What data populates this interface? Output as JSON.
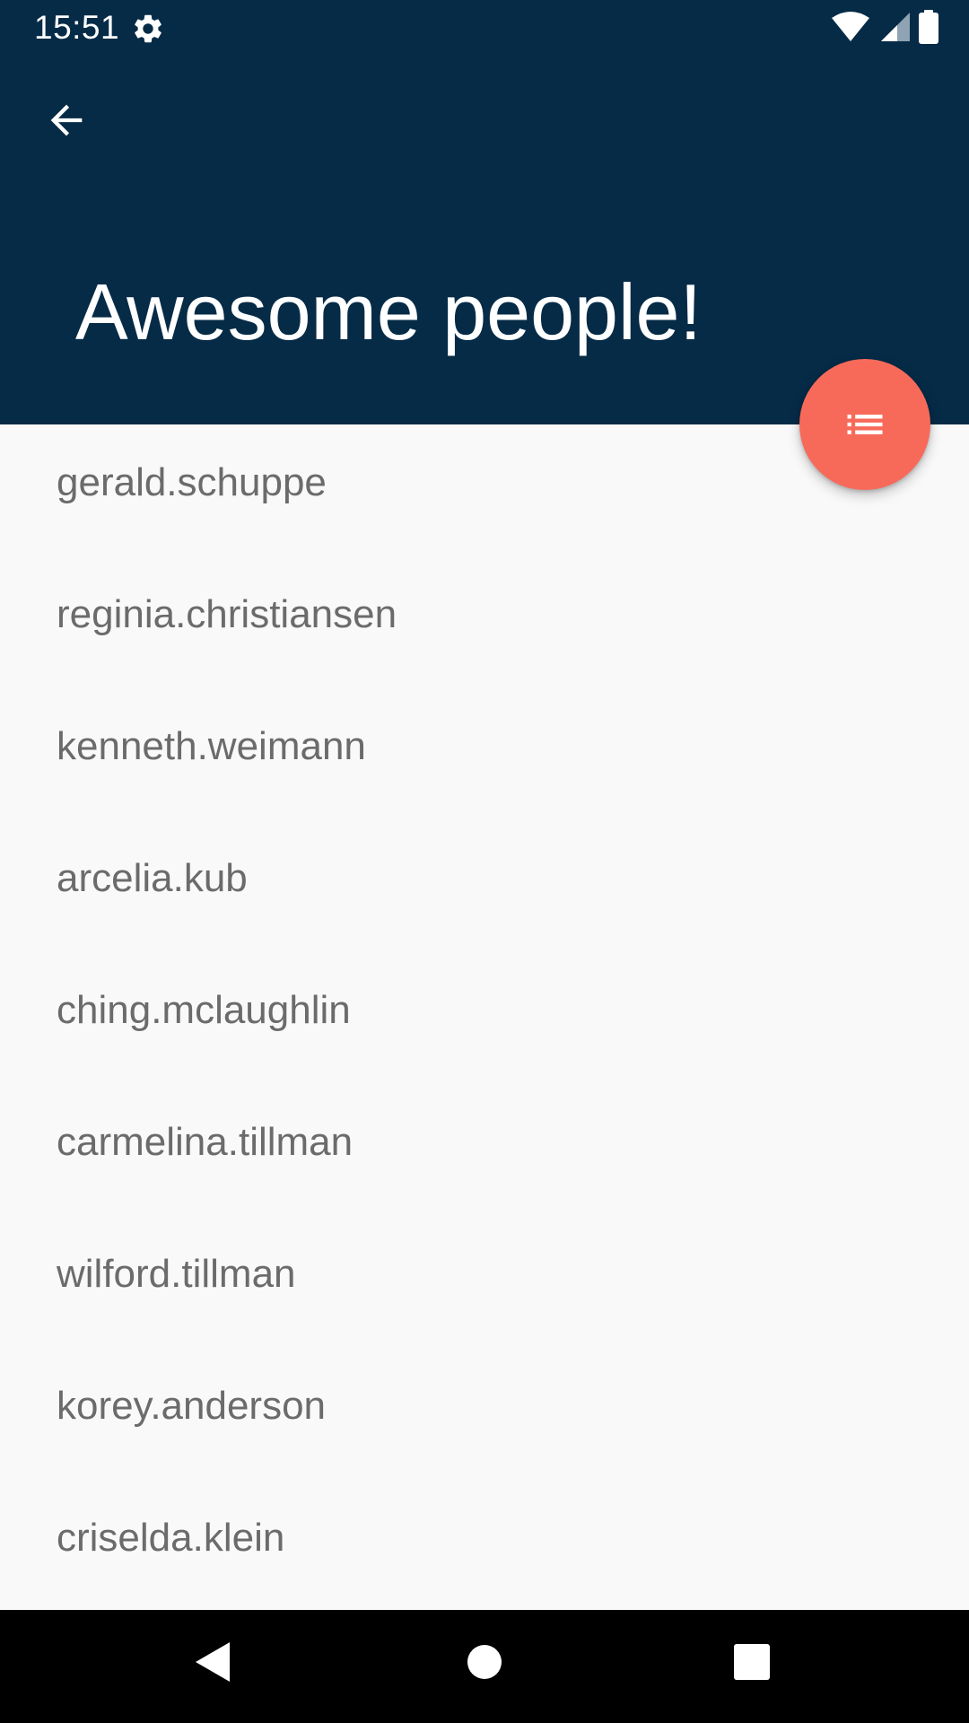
{
  "status_bar": {
    "time": "15:51",
    "icons": [
      "settings-icon",
      "wifi-icon",
      "cellular-signal-icon",
      "battery-icon"
    ]
  },
  "app_bar": {
    "title": "Awesome people!",
    "back_icon": "arrow-back-icon"
  },
  "fab": {
    "icon": "list-icon"
  },
  "people": [
    "gerald.schuppe",
    "reginia.christiansen",
    "kenneth.weimann",
    "arcelia.kub",
    "ching.mclaughlin",
    "carmelina.tillman",
    "wilford.tillman",
    "korey.anderson",
    "criselda.klein"
  ],
  "nav_bar": {
    "icons": [
      "back-triangle-icon",
      "home-circle-icon",
      "recents-square-icon"
    ]
  },
  "colors": {
    "header": "#062b47",
    "fab": "#f76a5a",
    "list_background": "#f9f9fa",
    "list_text": "#6b6b6b",
    "nav_bar": "#000000"
  }
}
